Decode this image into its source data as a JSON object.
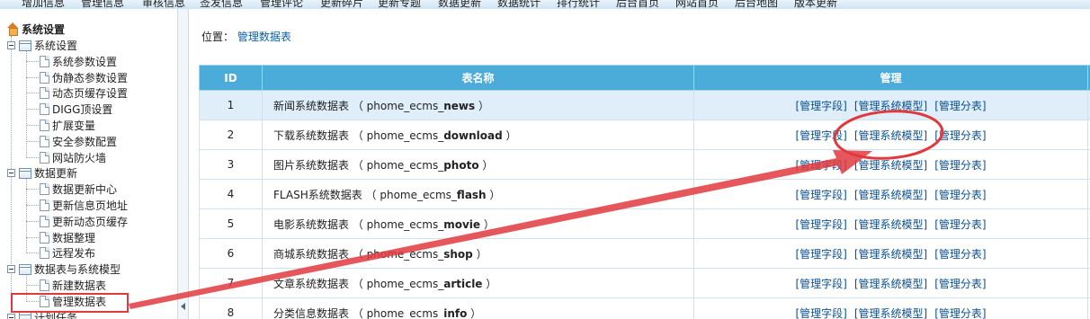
{
  "topnav": {
    "items": [
      "增加信息",
      "管理信息",
      "审核信息",
      "签发信息",
      "管理评论",
      "更新碎片",
      "更新专题",
      "数据更新",
      "数据统计",
      "排行统计",
      "后台首页",
      "网站首页",
      "后台地图",
      "版本更新"
    ]
  },
  "sidebar": {
    "root_label": "系统设置",
    "groups": [
      {
        "label": "系统设置",
        "items": [
          "系统参数设置",
          "伪静态参数设置",
          "动态页缓存设置",
          "DIGG顶设置",
          "扩展变量",
          "安全参数配置",
          "网站防火墙"
        ]
      },
      {
        "label": "数据更新",
        "items": [
          "数据更新中心",
          "更新信息页地址",
          "更新动态页缓存",
          "数据整理",
          "远程发布"
        ]
      },
      {
        "label": "数据表与系统模型",
        "items": [
          "新建数据表",
          "管理数据表"
        ]
      },
      {
        "label": "计划任务",
        "items": []
      }
    ]
  },
  "location": {
    "prefix": "位置：",
    "link": "管理数据表"
  },
  "table": {
    "headers": [
      "ID",
      "表名称",
      "管理"
    ],
    "ops": [
      "[管理字段]",
      "[管理系统模型]",
      "[管理分表]"
    ],
    "rows": [
      {
        "id": "1",
        "name": "新闻系统数据表",
        "prefix": "phome_ecms_",
        "suffix": "news"
      },
      {
        "id": "2",
        "name": "下载系统数据表",
        "prefix": "phome_ecms_",
        "suffix": "download"
      },
      {
        "id": "3",
        "name": "图片系统数据表",
        "prefix": "phome_ecms_",
        "suffix": "photo"
      },
      {
        "id": "4",
        "name": "FLASH系统数据表",
        "prefix": "phome_ecms_",
        "suffix": "flash"
      },
      {
        "id": "5",
        "name": "电影系统数据表",
        "prefix": "phome_ecms_",
        "suffix": "movie"
      },
      {
        "id": "6",
        "name": "商城系统数据表",
        "prefix": "phome_ecms_",
        "suffix": "shop"
      },
      {
        "id": "7",
        "name": "文章系统数据表",
        "prefix": "phome_ecms_",
        "suffix": "article"
      },
      {
        "id": "8",
        "name": "分类信息数据表",
        "prefix": "phome_ecms_",
        "suffix": "info"
      }
    ]
  },
  "colors": {
    "header_bg": "#4bacd9",
    "annotation": "#e0393e",
    "highlight_row": "#dfeef9",
    "link": "#0b4f8f"
  }
}
